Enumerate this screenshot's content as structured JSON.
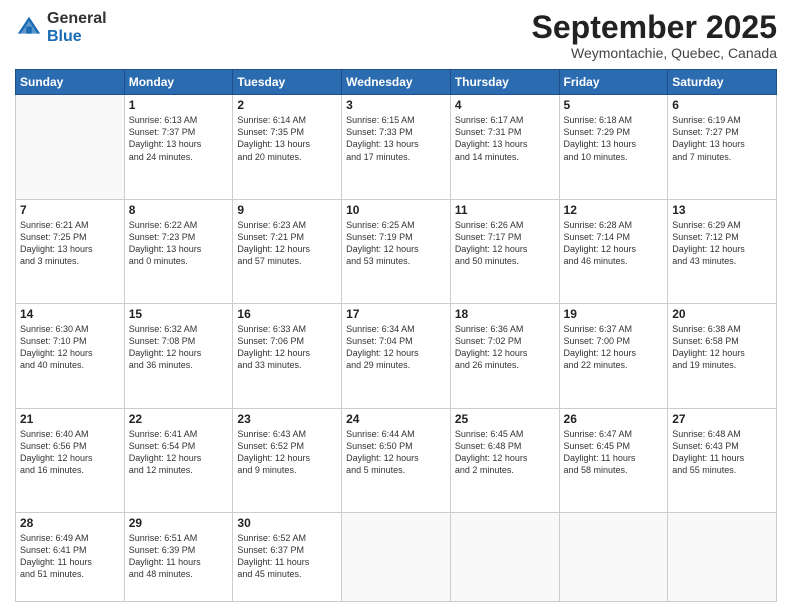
{
  "header": {
    "logo_general": "General",
    "logo_blue": "Blue",
    "month": "September 2025",
    "location": "Weymontachie, Quebec, Canada"
  },
  "days_of_week": [
    "Sunday",
    "Monday",
    "Tuesday",
    "Wednesday",
    "Thursday",
    "Friday",
    "Saturday"
  ],
  "weeks": [
    [
      {
        "day": "",
        "info": ""
      },
      {
        "day": "1",
        "info": "Sunrise: 6:13 AM\nSunset: 7:37 PM\nDaylight: 13 hours\nand 24 minutes."
      },
      {
        "day": "2",
        "info": "Sunrise: 6:14 AM\nSunset: 7:35 PM\nDaylight: 13 hours\nand 20 minutes."
      },
      {
        "day": "3",
        "info": "Sunrise: 6:15 AM\nSunset: 7:33 PM\nDaylight: 13 hours\nand 17 minutes."
      },
      {
        "day": "4",
        "info": "Sunrise: 6:17 AM\nSunset: 7:31 PM\nDaylight: 13 hours\nand 14 minutes."
      },
      {
        "day": "5",
        "info": "Sunrise: 6:18 AM\nSunset: 7:29 PM\nDaylight: 13 hours\nand 10 minutes."
      },
      {
        "day": "6",
        "info": "Sunrise: 6:19 AM\nSunset: 7:27 PM\nDaylight: 13 hours\nand 7 minutes."
      }
    ],
    [
      {
        "day": "7",
        "info": "Sunrise: 6:21 AM\nSunset: 7:25 PM\nDaylight: 13 hours\nand 3 minutes."
      },
      {
        "day": "8",
        "info": "Sunrise: 6:22 AM\nSunset: 7:23 PM\nDaylight: 13 hours\nand 0 minutes."
      },
      {
        "day": "9",
        "info": "Sunrise: 6:23 AM\nSunset: 7:21 PM\nDaylight: 12 hours\nand 57 minutes."
      },
      {
        "day": "10",
        "info": "Sunrise: 6:25 AM\nSunset: 7:19 PM\nDaylight: 12 hours\nand 53 minutes."
      },
      {
        "day": "11",
        "info": "Sunrise: 6:26 AM\nSunset: 7:17 PM\nDaylight: 12 hours\nand 50 minutes."
      },
      {
        "day": "12",
        "info": "Sunrise: 6:28 AM\nSunset: 7:14 PM\nDaylight: 12 hours\nand 46 minutes."
      },
      {
        "day": "13",
        "info": "Sunrise: 6:29 AM\nSunset: 7:12 PM\nDaylight: 12 hours\nand 43 minutes."
      }
    ],
    [
      {
        "day": "14",
        "info": "Sunrise: 6:30 AM\nSunset: 7:10 PM\nDaylight: 12 hours\nand 40 minutes."
      },
      {
        "day": "15",
        "info": "Sunrise: 6:32 AM\nSunset: 7:08 PM\nDaylight: 12 hours\nand 36 minutes."
      },
      {
        "day": "16",
        "info": "Sunrise: 6:33 AM\nSunset: 7:06 PM\nDaylight: 12 hours\nand 33 minutes."
      },
      {
        "day": "17",
        "info": "Sunrise: 6:34 AM\nSunset: 7:04 PM\nDaylight: 12 hours\nand 29 minutes."
      },
      {
        "day": "18",
        "info": "Sunrise: 6:36 AM\nSunset: 7:02 PM\nDaylight: 12 hours\nand 26 minutes."
      },
      {
        "day": "19",
        "info": "Sunrise: 6:37 AM\nSunset: 7:00 PM\nDaylight: 12 hours\nand 22 minutes."
      },
      {
        "day": "20",
        "info": "Sunrise: 6:38 AM\nSunset: 6:58 PM\nDaylight: 12 hours\nand 19 minutes."
      }
    ],
    [
      {
        "day": "21",
        "info": "Sunrise: 6:40 AM\nSunset: 6:56 PM\nDaylight: 12 hours\nand 16 minutes."
      },
      {
        "day": "22",
        "info": "Sunrise: 6:41 AM\nSunset: 6:54 PM\nDaylight: 12 hours\nand 12 minutes."
      },
      {
        "day": "23",
        "info": "Sunrise: 6:43 AM\nSunset: 6:52 PM\nDaylight: 12 hours\nand 9 minutes."
      },
      {
        "day": "24",
        "info": "Sunrise: 6:44 AM\nSunset: 6:50 PM\nDaylight: 12 hours\nand 5 minutes."
      },
      {
        "day": "25",
        "info": "Sunrise: 6:45 AM\nSunset: 6:48 PM\nDaylight: 12 hours\nand 2 minutes."
      },
      {
        "day": "26",
        "info": "Sunrise: 6:47 AM\nSunset: 6:45 PM\nDaylight: 11 hours\nand 58 minutes."
      },
      {
        "day": "27",
        "info": "Sunrise: 6:48 AM\nSunset: 6:43 PM\nDaylight: 11 hours\nand 55 minutes."
      }
    ],
    [
      {
        "day": "28",
        "info": "Sunrise: 6:49 AM\nSunset: 6:41 PM\nDaylight: 11 hours\nand 51 minutes."
      },
      {
        "day": "29",
        "info": "Sunrise: 6:51 AM\nSunset: 6:39 PM\nDaylight: 11 hours\nand 48 minutes."
      },
      {
        "day": "30",
        "info": "Sunrise: 6:52 AM\nSunset: 6:37 PM\nDaylight: 11 hours\nand 45 minutes."
      },
      {
        "day": "",
        "info": ""
      },
      {
        "day": "",
        "info": ""
      },
      {
        "day": "",
        "info": ""
      },
      {
        "day": "",
        "info": ""
      }
    ]
  ]
}
